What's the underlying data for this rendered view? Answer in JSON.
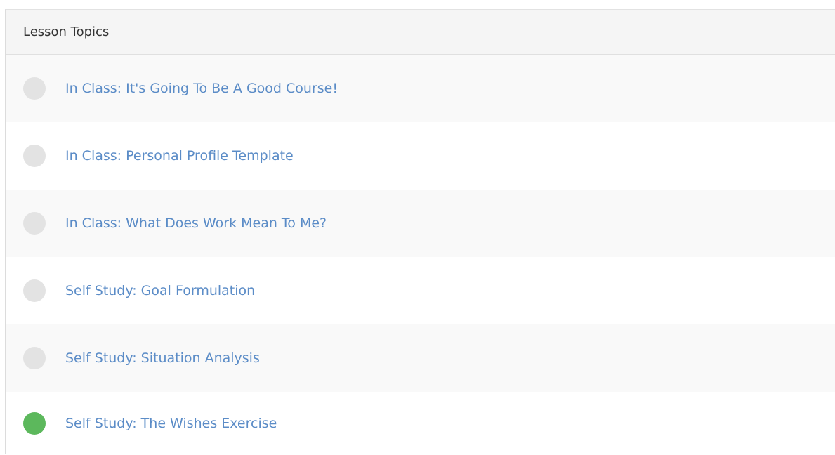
{
  "panel": {
    "title": "Lesson Topics"
  },
  "topics": [
    {
      "label": "In Class: It's Going To Be A Good Course!",
      "status": "incomplete"
    },
    {
      "label": "In Class: Personal Profile Template",
      "status": "incomplete"
    },
    {
      "label": "In Class: What Does Work Mean To Me?",
      "status": "incomplete"
    },
    {
      "label": "Self Study: Goal Formulation",
      "status": "incomplete"
    },
    {
      "label": "Self Study: Situation Analysis",
      "status": "incomplete"
    },
    {
      "label": "Self Study: The Wishes Exercise",
      "status": "complete"
    }
  ],
  "colors": {
    "complete": "#5cb85c",
    "incomplete": "#e3e3e3",
    "link": "#5b8cc7"
  }
}
